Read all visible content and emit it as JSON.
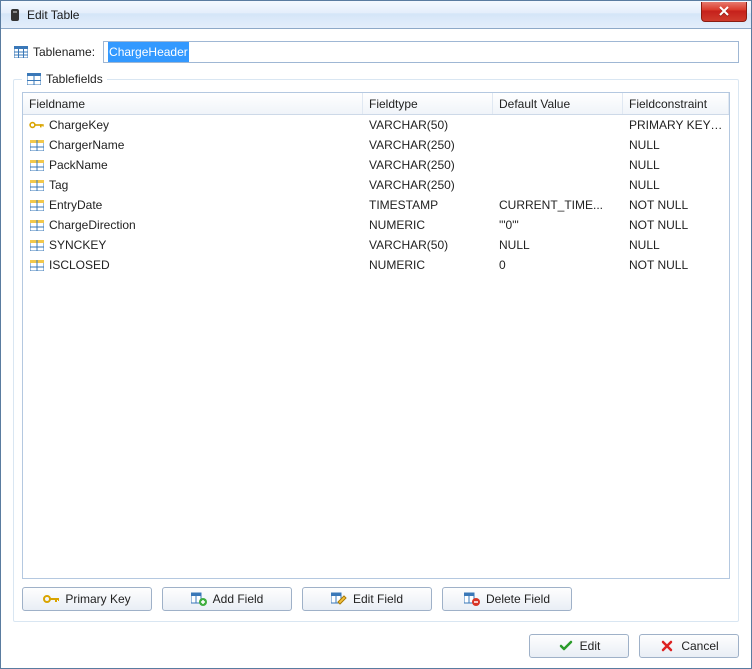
{
  "window": {
    "title": "Edit Table"
  },
  "form": {
    "tablename_label": "Tablename:",
    "tablename_value": "ChargeHeader",
    "tablefields_label": "Tablefields"
  },
  "columns": {
    "fieldname": "Fieldname",
    "fieldtype": "Fieldtype",
    "defaultvalue": "Default Value",
    "fieldconstraint": "Fieldconstraint"
  },
  "fields": [
    {
      "pk": true,
      "name": "ChargeKey",
      "type": "VARCHAR(50)",
      "default": "",
      "constraint": "PRIMARY KEY N..."
    },
    {
      "pk": false,
      "name": "ChargerName",
      "type": "VARCHAR(250)",
      "default": "",
      "constraint": "NULL"
    },
    {
      "pk": false,
      "name": "PackName",
      "type": "VARCHAR(250)",
      "default": "",
      "constraint": "NULL"
    },
    {
      "pk": false,
      "name": "Tag",
      "type": "VARCHAR(250)",
      "default": "",
      "constraint": "NULL"
    },
    {
      "pk": false,
      "name": "EntryDate",
      "type": "TIMESTAMP",
      "default": "CURRENT_TIME...",
      "constraint": "NOT NULL"
    },
    {
      "pk": false,
      "name": "ChargeDirection",
      "type": "NUMERIC",
      "default": "'\"0\"'",
      "constraint": "NOT NULL"
    },
    {
      "pk": false,
      "name": "SYNCKEY",
      "type": "VARCHAR(50)",
      "default": "NULL",
      "constraint": "NULL"
    },
    {
      "pk": false,
      "name": "ISCLOSED",
      "type": "NUMERIC",
      "default": "0",
      "constraint": "NOT NULL"
    }
  ],
  "buttons": {
    "primary_key": "Primary Key",
    "add_field": "Add Field",
    "edit_field": "Edit Field",
    "delete_field": "Delete Field",
    "edit": "Edit",
    "cancel": "Cancel"
  }
}
